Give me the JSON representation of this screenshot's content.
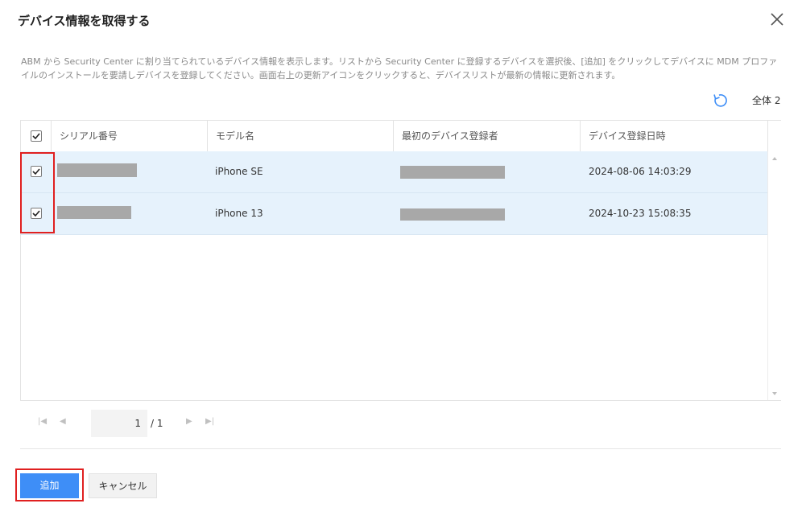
{
  "dialog": {
    "title": "デバイス情報を取得する",
    "description": "ABM から Security Center に割り当てられているデバイス情報を表示します。リストから Security Center に登録するデバイスを選択後、[追加] をクリックしてデバイスに MDM プロファイルのインストールを要請しデバイスを登録してください。画面右上の更新アイコンをクリックすると、デバイスリストが最新の情報に更新されます。",
    "total_label": "全体 2"
  },
  "table": {
    "columns": [
      "シリアル番号",
      "モデル名",
      "最初のデバイス登録者",
      "デバイス登録日時"
    ],
    "rows": [
      {
        "serial": "",
        "model": "iPhone SE",
        "registrant": "",
        "date": "2024-08-06 14:03:29",
        "checked": true
      },
      {
        "serial": "",
        "model": "iPhone 13",
        "registrant": "",
        "date": "2024-10-23 15:08:35",
        "checked": true
      }
    ]
  },
  "pagination": {
    "current": "1",
    "total": "/ 1"
  },
  "buttons": {
    "add": "追加",
    "cancel": "キャンセル"
  },
  "colors": {
    "primary": "#3e8ef7",
    "selected_row": "#e6f2fc",
    "highlight": "#e02020"
  },
  "icons": [
    "close-icon",
    "refresh-icon",
    "checkbox-checked-icon",
    "first-page-icon",
    "prev-page-icon",
    "next-page-icon",
    "last-page-icon",
    "scroll-up-icon",
    "scroll-down-icon"
  ]
}
